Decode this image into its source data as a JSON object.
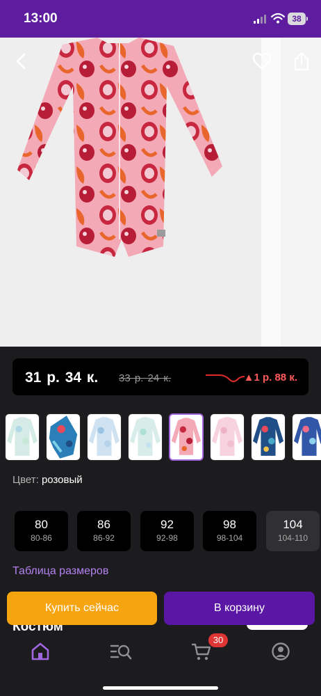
{
  "status_bar": {
    "time": "13:00",
    "battery": "38"
  },
  "price": {
    "current": "31 р. 34 к.",
    "old": "33 р. 24 к.",
    "change": "▲1 р. 88 к."
  },
  "color": {
    "label": "Цвет: ",
    "value": "розовый"
  },
  "variants": [
    "mint-white",
    "blue-floral",
    "light-blue",
    "mint-blue",
    "pink-selected",
    "light-pink",
    "navy-floral",
    "blue-floral-2"
  ],
  "sizes": [
    {
      "main": "80",
      "range": "80-86"
    },
    {
      "main": "86",
      "range": "86-92"
    },
    {
      "main": "92",
      "range": "92-98"
    },
    {
      "main": "98",
      "range": "98-104"
    },
    {
      "main": "104",
      "range": "104-110"
    }
  ],
  "size_table_link": "Таблица размеров",
  "product_title_peek": "Костюм",
  "buttons": {
    "buy_now": "Купить сейчас",
    "add_to_cart": "В корзину"
  },
  "tab_bar": {
    "cart_count": "30"
  },
  "colors": {
    "brand_purple": "#5e1d9e",
    "accent_orange": "#f6a40f",
    "link_purple": "#b382f0",
    "price_up_red": "#ff5b5b"
  }
}
